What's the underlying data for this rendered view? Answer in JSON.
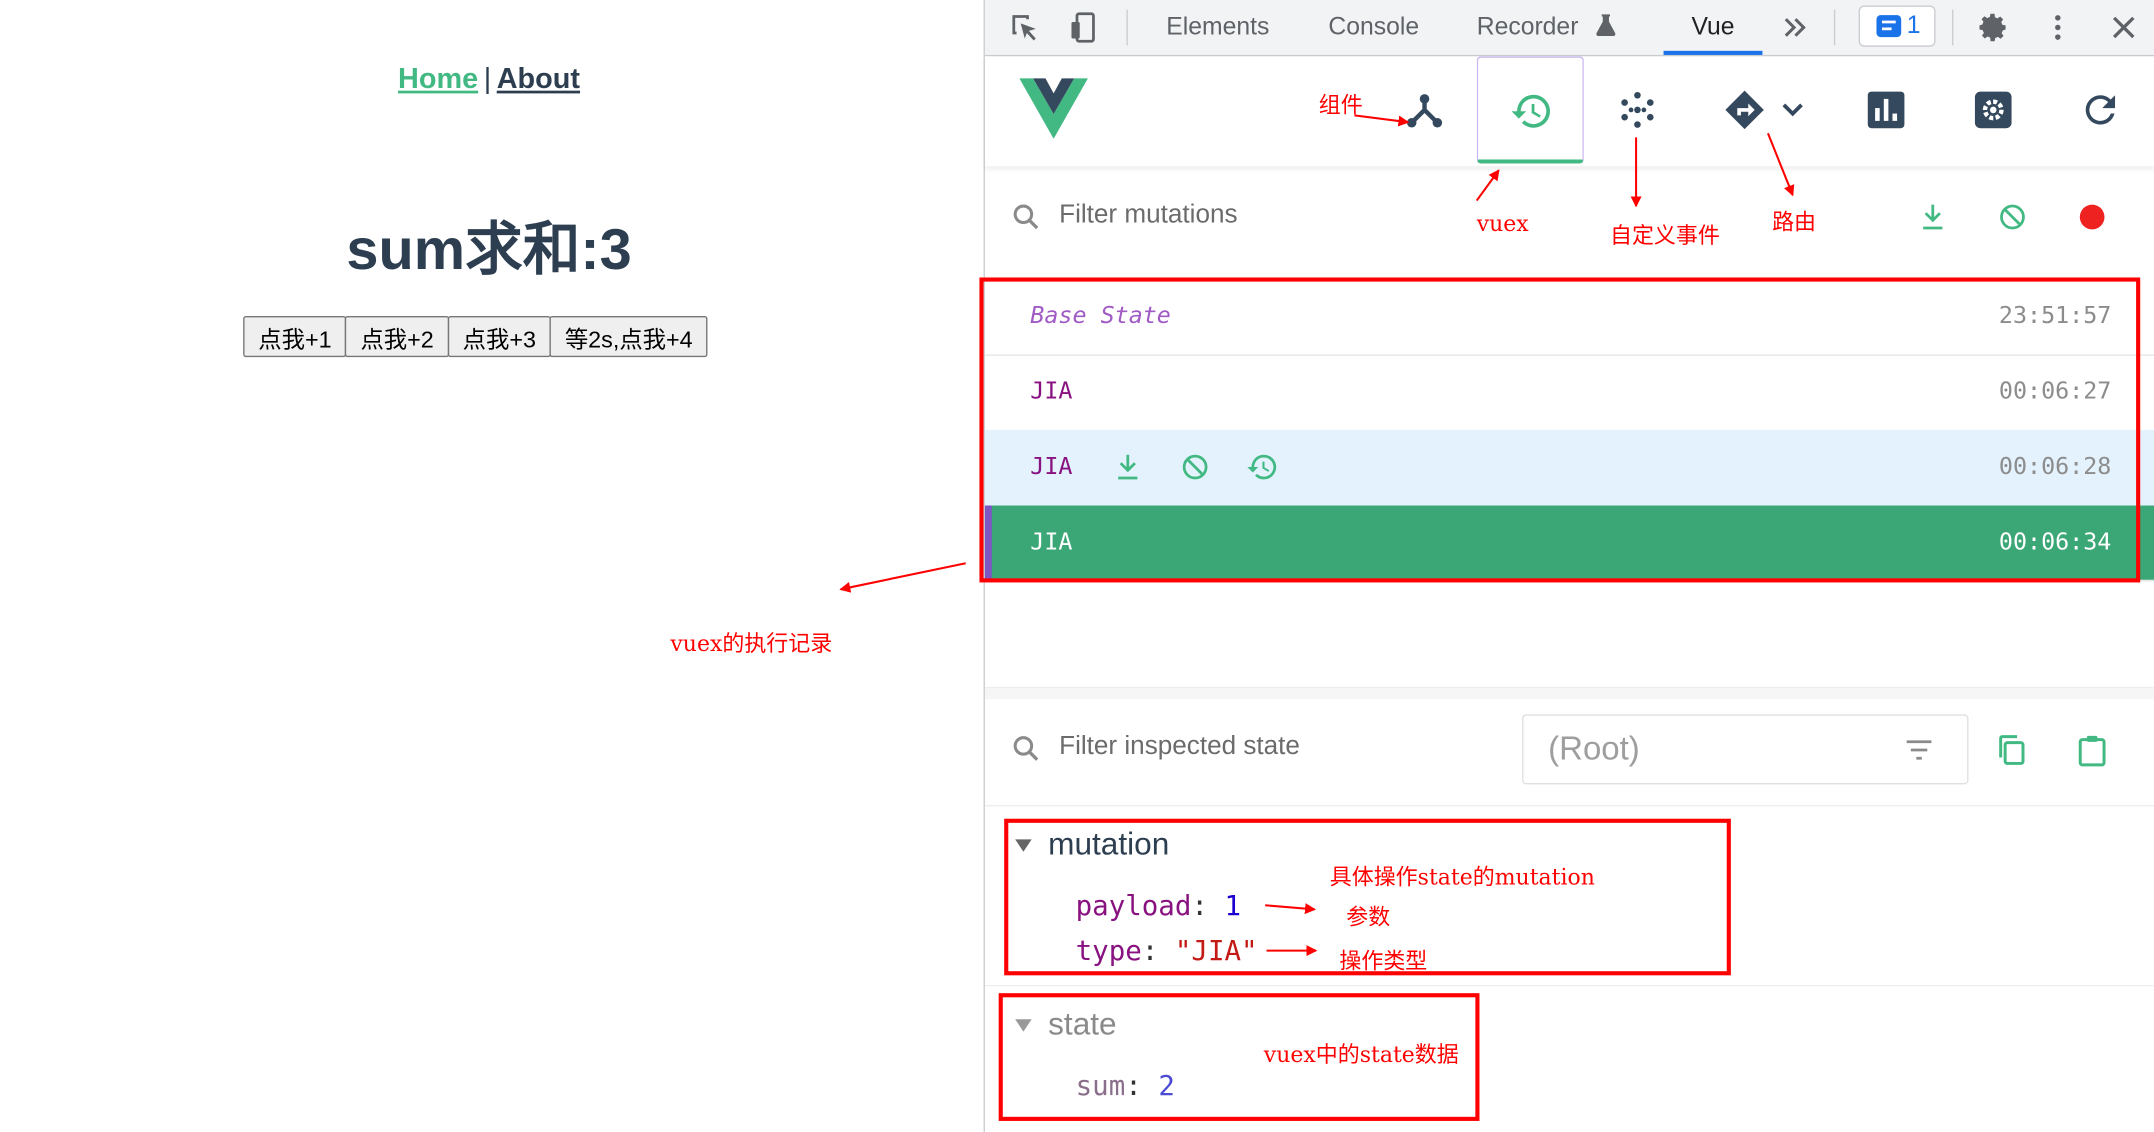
{
  "app": {
    "nav": {
      "home": "Home",
      "separator": "|",
      "about": "About"
    },
    "sum_title": "sum求和:3",
    "buttons": [
      "点我+1",
      "点我+2",
      "点我+3",
      "等2s,点我+4"
    ]
  },
  "devtools": {
    "tabs": [
      "Elements",
      "Console",
      "Recorder",
      "Vue"
    ],
    "active_tab": "Vue",
    "message_count": "1",
    "vue": {
      "toolbar": [
        "components",
        "vuex-timeline",
        "custom-events",
        "router",
        "performance",
        "settings",
        "refresh"
      ],
      "active_tool": "vuex-timeline",
      "filter_mutations_placeholder": "Filter mutations",
      "mutations": [
        {
          "label": "Base State",
          "time": "23:51:57",
          "state": "base"
        },
        {
          "label": "JIA",
          "time": "00:06:27",
          "state": "normal"
        },
        {
          "label": "JIA",
          "time": "00:06:28",
          "state": "hover"
        },
        {
          "label": "JIA",
          "time": "00:06:34",
          "state": "selected"
        }
      ],
      "filter_state_placeholder": "Filter inspected state",
      "root_selector": "(Root)",
      "mutation_section": {
        "title": "mutation",
        "payload_key": "payload",
        "payload_value": "1",
        "type_key": "type",
        "type_value": "\"JIA\""
      },
      "state_section": {
        "title": "state",
        "sum_key": "sum",
        "sum_value": "2"
      }
    }
  },
  "annotations": {
    "components": "组件",
    "vuex": "vuex",
    "custom_events": "自定义事件",
    "router": "路由",
    "vuex_record": "vuex的执行记录",
    "mutation_desc": "具体操作state的mutation",
    "params": "参数",
    "op_type": "操作类型",
    "state_data": "vuex中的state数据"
  },
  "colors": {
    "vue_green": "#42b983",
    "annotation_red": "#ff0000",
    "selected_row": "#3ba776",
    "devtools_blue": "#1a73e8"
  }
}
